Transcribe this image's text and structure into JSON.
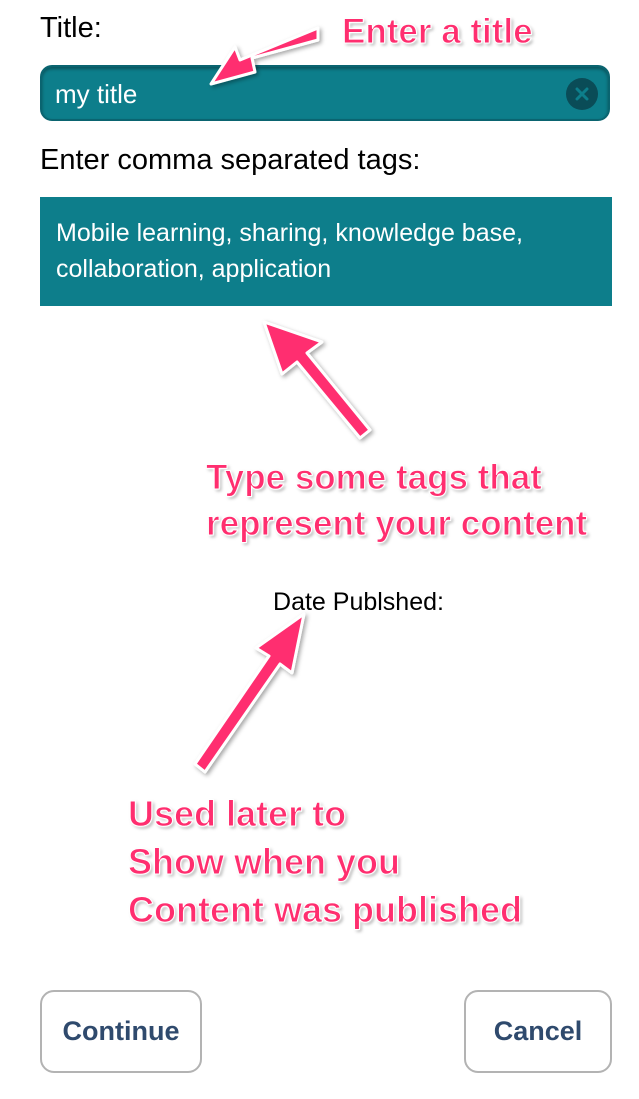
{
  "form": {
    "title_label": "Title:",
    "title_value": "my title",
    "tags_label": "Enter comma separated tags:",
    "tags_line1": "Mobile learning, sharing, knowledge base,",
    "tags_line2": "collaboration, application",
    "date_label": "Date Publshed:"
  },
  "buttons": {
    "continue_label": "Continue",
    "cancel_label": "Cancel"
  },
  "annotations": {
    "title_note": "Enter a title",
    "tags_note_line1": "Type some tags that",
    "tags_note_line2": "represent your content",
    "date_note_line1": "Used later to",
    "date_note_line2": "Show when you",
    "date_note_line3": "Content was published"
  },
  "colors": {
    "field_bg": "#0d7e8b",
    "annotation": "#ff2e6f",
    "button_text": "#2f4a6d"
  },
  "icons": {
    "clear": "clear-x-circle-icon",
    "arrows": "annotation-arrow-icon"
  }
}
